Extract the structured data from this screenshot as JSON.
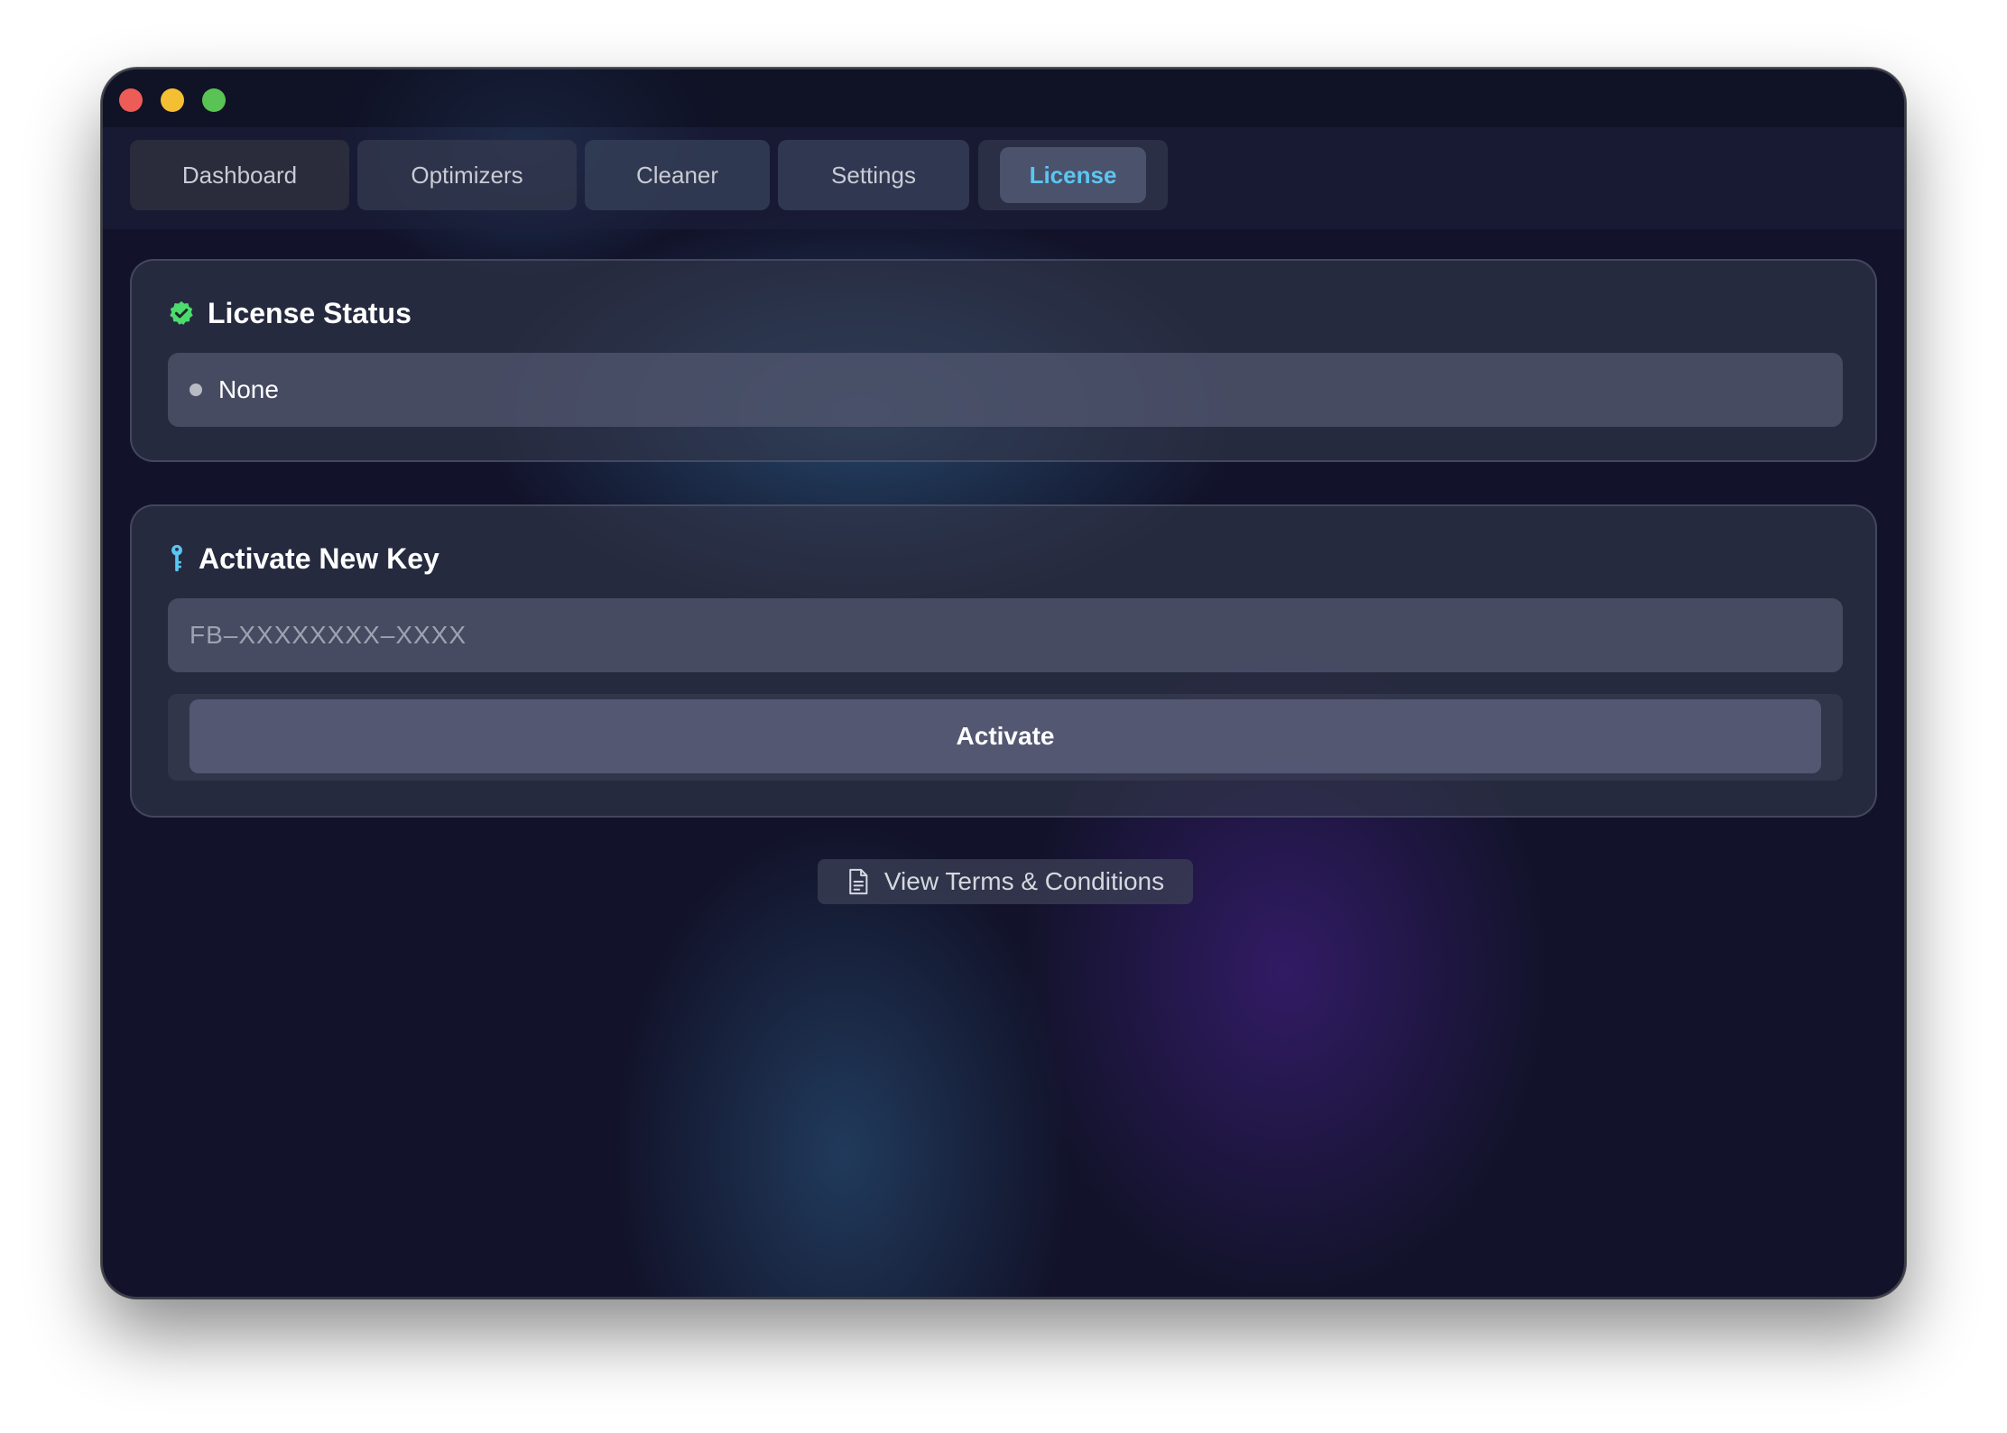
{
  "window": {
    "controls": [
      "close",
      "minimize",
      "maximize"
    ]
  },
  "tabs": [
    {
      "label": "Dashboard",
      "active": false
    },
    {
      "label": "Optimizers",
      "active": false
    },
    {
      "label": "Cleaner",
      "active": false
    },
    {
      "label": "Settings",
      "active": false
    },
    {
      "label": "License",
      "active": true
    }
  ],
  "license_status": {
    "title": "License Status",
    "icon": "verified-badge-icon",
    "status_value": "None"
  },
  "activate": {
    "title": "Activate New Key",
    "icon": "key-icon",
    "input_value": "",
    "input_placeholder": "FB–XXXXXXXX–XXXX",
    "button_label": "Activate"
  },
  "terms": {
    "label": "View Terms & Conditions",
    "icon": "document-icon"
  },
  "colors": {
    "accent": "#5cc6f0",
    "verified": "#4ddb6e",
    "key": "#5cc6f0"
  }
}
